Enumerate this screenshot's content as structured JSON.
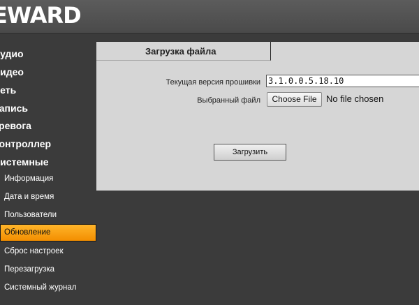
{
  "header": {
    "logo_text": "EWARD"
  },
  "sidebar": {
    "top_items": [
      {
        "label": "Аудио"
      },
      {
        "label": "Видео"
      },
      {
        "label": "Сеть"
      },
      {
        "label": "Запись"
      },
      {
        "label": "Тревога"
      },
      {
        "label": "Контроллер"
      },
      {
        "label": "Системные"
      }
    ],
    "sub_items": [
      {
        "label": "Информация"
      },
      {
        "label": "Дата и время"
      },
      {
        "label": "Пользователи"
      },
      {
        "label": "Обновление",
        "active": true
      },
      {
        "label": "Сброс настроек"
      },
      {
        "label": "Перезагрузка"
      },
      {
        "label": "Системный журнал"
      }
    ],
    "active_color": "#f7a21b"
  },
  "main": {
    "tab_title": "Загрузка файла",
    "firmware_label": "Текущая версия прошивки",
    "firmware_value": "3.1.0.0.5.18.10",
    "file_label": "Выбранный файл",
    "choose_file_label": "Choose File",
    "no_file_text": "No file chosen",
    "upload_label": "Загрузить"
  }
}
